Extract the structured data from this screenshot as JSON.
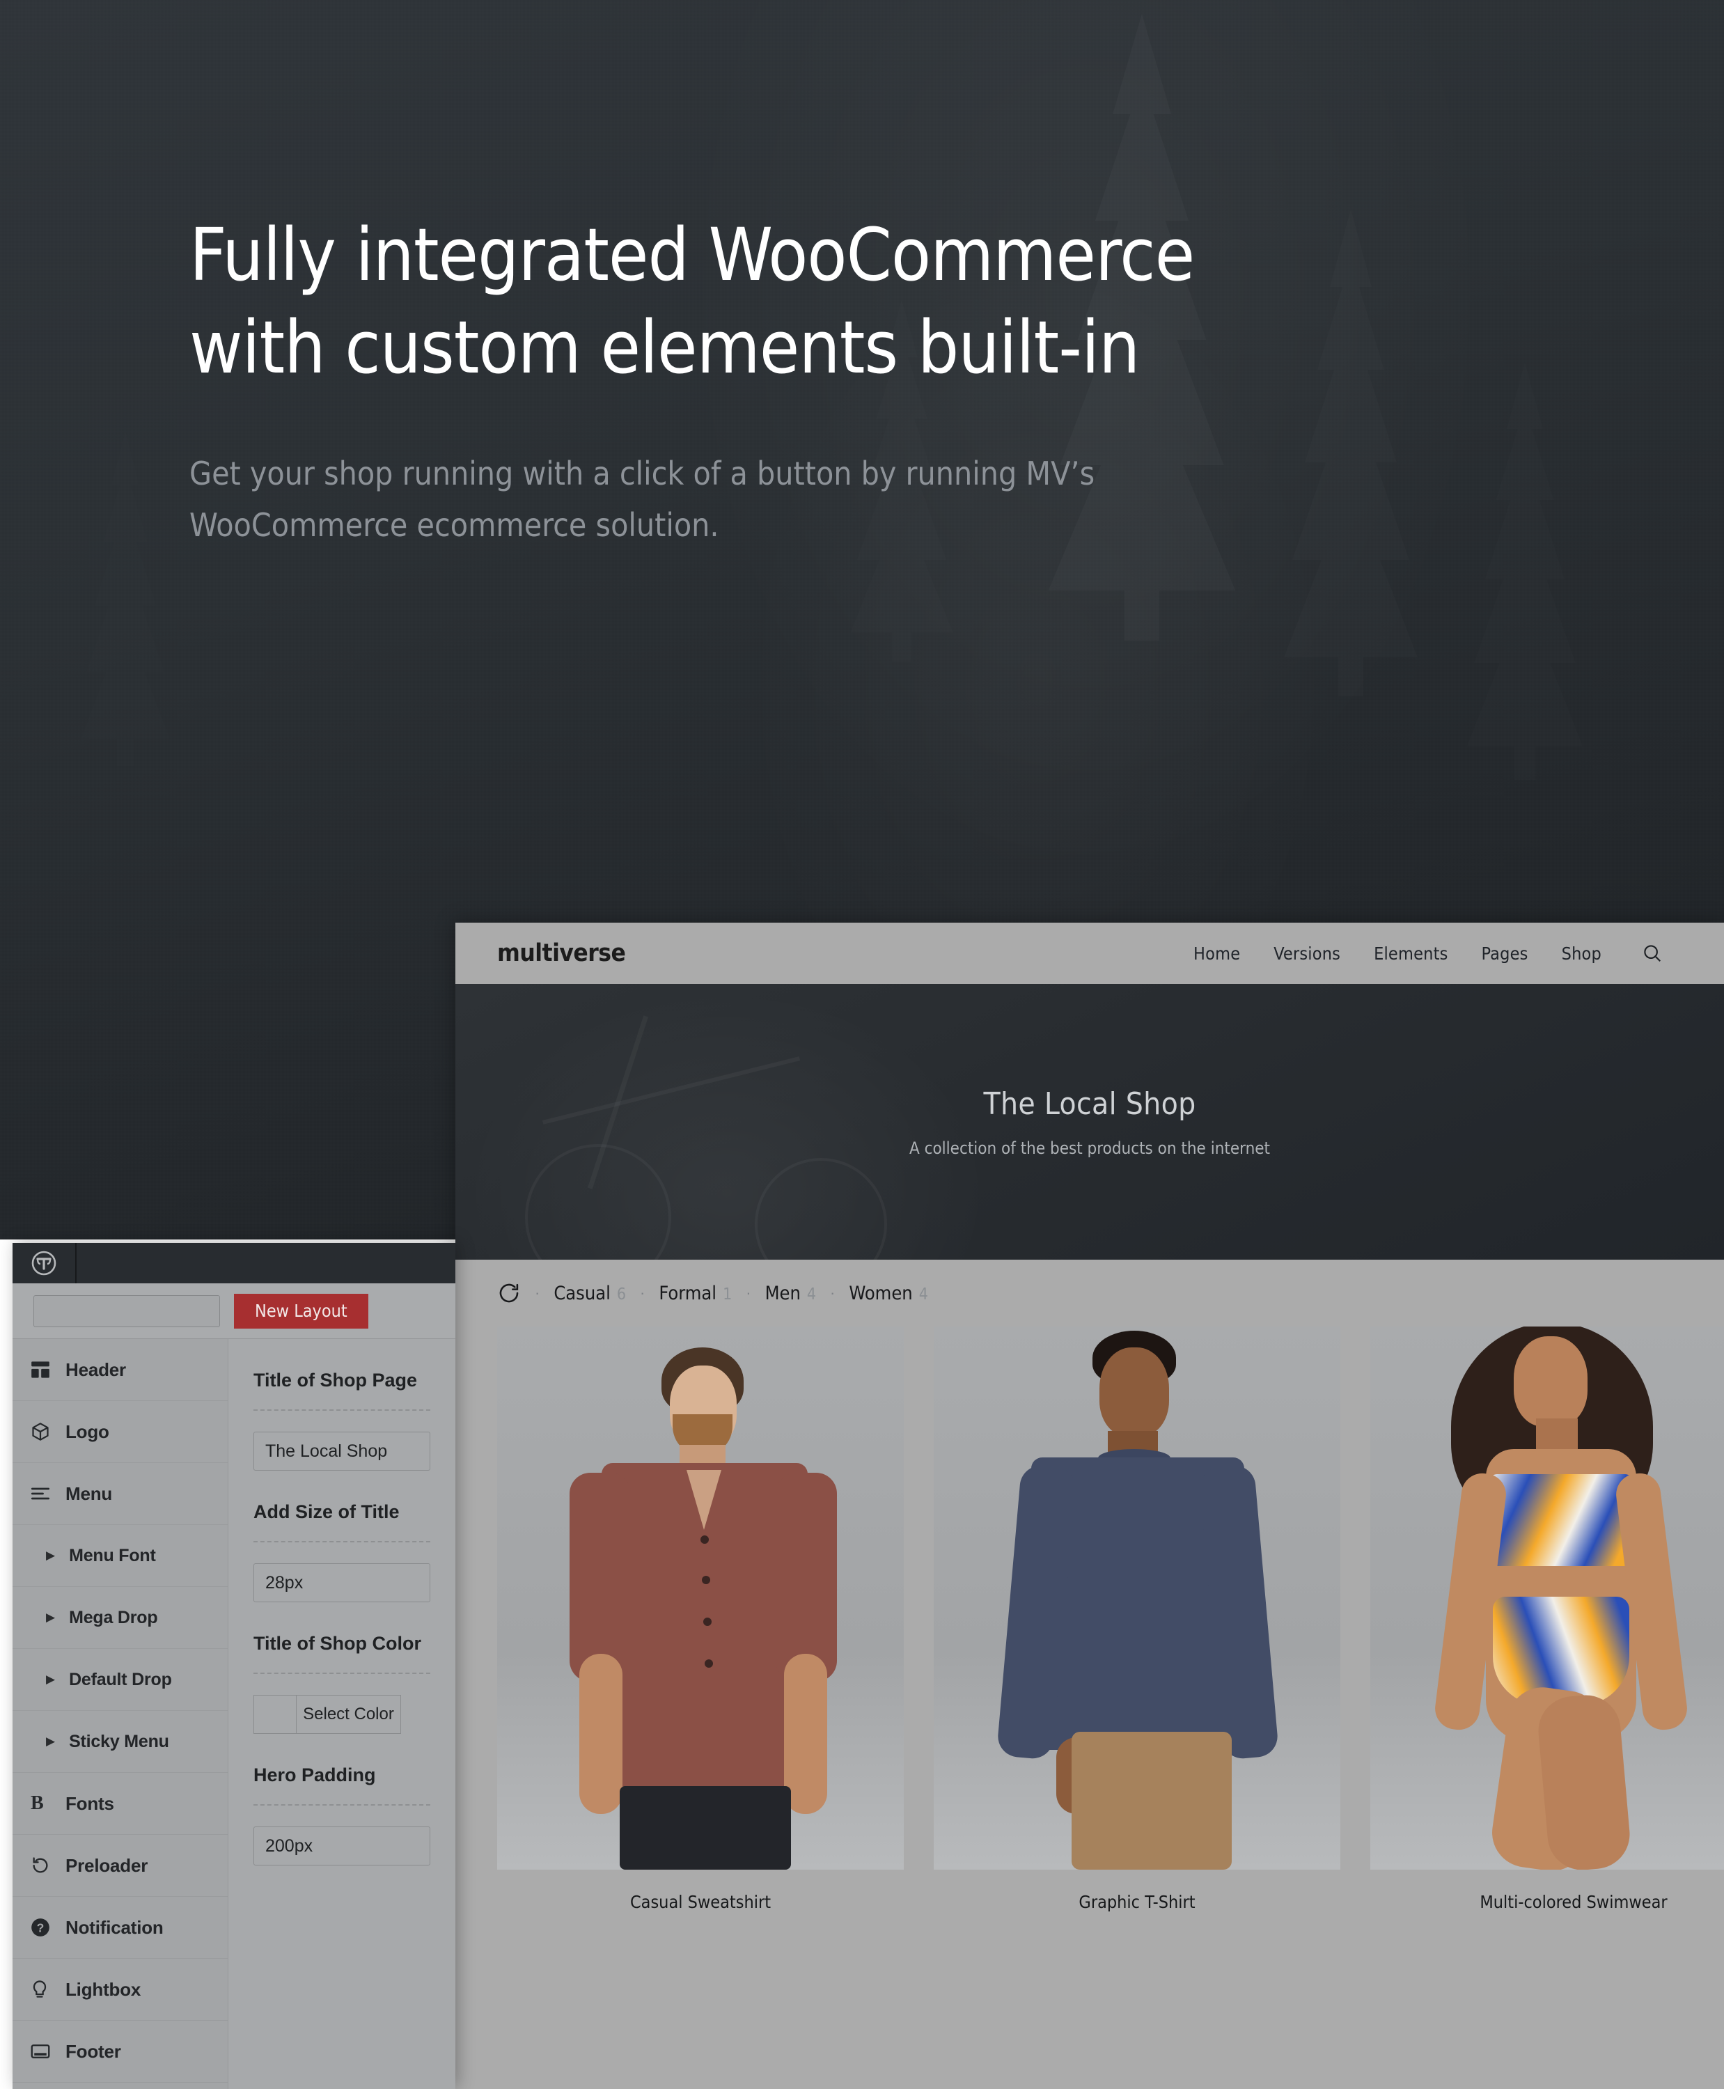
{
  "promo": {
    "title": "Fully integrated WooCommerce\nwith custom elements built-in",
    "subtitle": "Get your shop running with a click of a button by running MV’s\nWooCommerce ecommerce solution."
  },
  "site": {
    "logo": "multiverse",
    "nav": [
      {
        "label": "Home"
      },
      {
        "label": "Versions"
      },
      {
        "label": "Elements"
      },
      {
        "label": "Pages"
      },
      {
        "label": "Shop"
      }
    ],
    "search_icon": "search-icon",
    "hero": {
      "title": "The Local Shop",
      "subtitle": "A collection of the best products on the internet"
    },
    "filters": {
      "reload_icon": "reload-icon",
      "separator": "·",
      "items": [
        {
          "label": "Casual",
          "count": "6"
        },
        {
          "label": "Formal",
          "count": "1"
        },
        {
          "label": "Men",
          "count": "4"
        },
        {
          "label": "Women",
          "count": "4"
        }
      ]
    },
    "products": [
      {
        "name": "Casual Sweatshirt"
      },
      {
        "name": "Graphic T-Shirt"
      },
      {
        "name": "Multi-colored Swimwear"
      }
    ]
  },
  "admin": {
    "brand_icon": "multiverse-logo-icon",
    "toolbar": {
      "layout_name_value": "",
      "layout_name_placeholder": "",
      "new_layout_label": "New Layout"
    },
    "sidebar": [
      {
        "label": "Header",
        "icon": "layout-header-icon",
        "sub": false
      },
      {
        "label": "Logo",
        "icon": "cube-icon",
        "sub": false
      },
      {
        "label": "Menu",
        "icon": "menu-lines-icon",
        "sub": false
      },
      {
        "label": "Menu Font",
        "icon": "caret-right-icon",
        "sub": true
      },
      {
        "label": "Mega Drop",
        "icon": "caret-right-icon",
        "sub": true
      },
      {
        "label": "Default Drop",
        "icon": "caret-right-icon",
        "sub": true
      },
      {
        "label": "Sticky Menu",
        "icon": "caret-right-icon",
        "sub": true
      },
      {
        "label": "Fonts",
        "icon": "bold-b-icon",
        "sub": false
      },
      {
        "label": "Preloader",
        "icon": "refresh-icon",
        "sub": false
      },
      {
        "label": "Notification",
        "icon": "question-circle-icon",
        "sub": false
      },
      {
        "label": "Lightbox",
        "icon": "lightbulb-icon",
        "sub": false
      },
      {
        "label": "Footer",
        "icon": "footer-bar-icon",
        "sub": false
      }
    ],
    "settings": {
      "title_of_shop_page_label": "Title of Shop Page",
      "title_of_shop_page_value": "The Local Shop",
      "add_size_of_title_label": "Add Size of Title",
      "add_size_of_title_value": "28px",
      "title_of_shop_color_label": "Title of Shop Color",
      "select_color_label": "Select Color",
      "hero_padding_label": "Hero Padding",
      "hero_padding_value": "200px"
    }
  },
  "colors": {
    "accent_red": "#a72f30",
    "dark_bg": "#2b3034",
    "panel_gray": "#a3a5a7",
    "header_gray": "#ababab"
  }
}
